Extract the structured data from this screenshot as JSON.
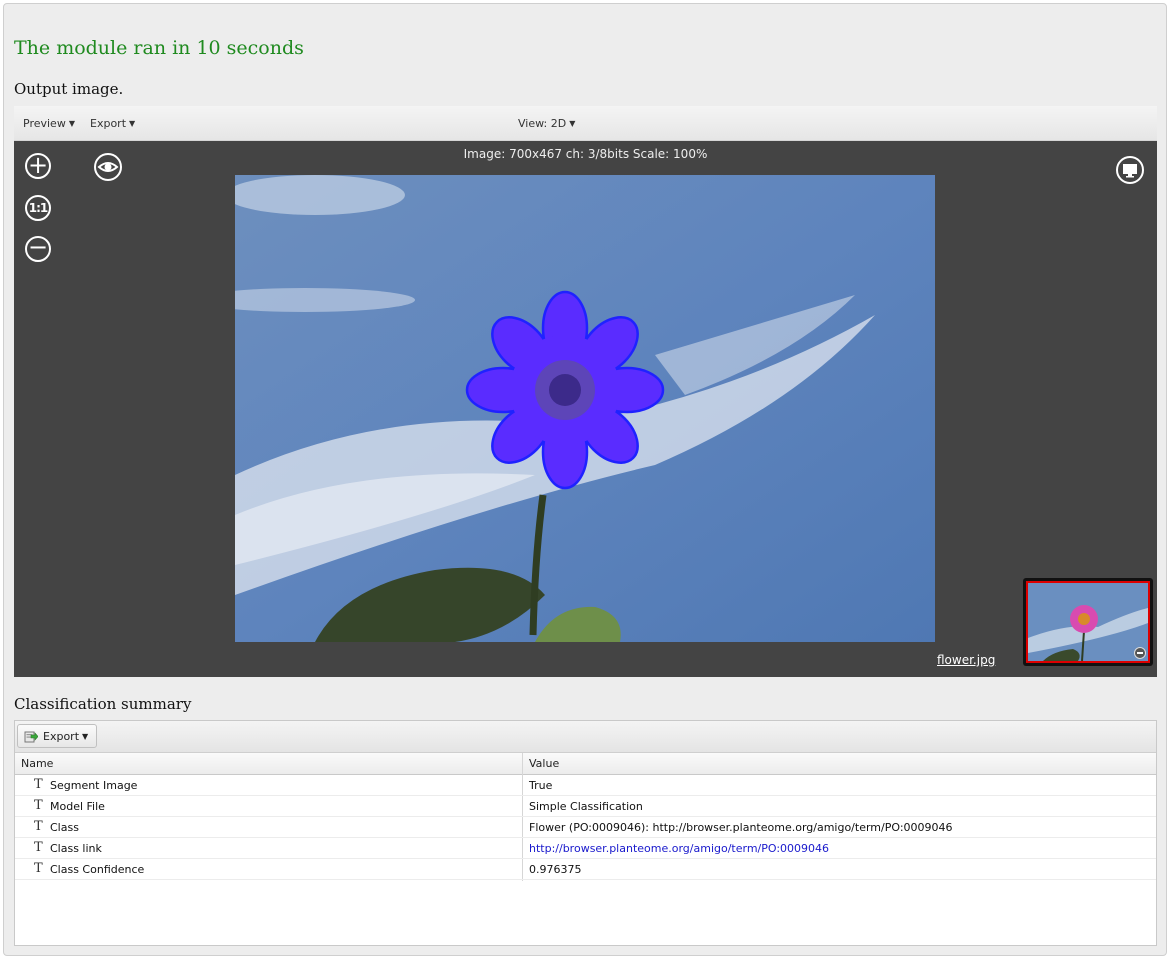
{
  "status_message": "The module ran in 10 seconds",
  "output_section": {
    "title": "Output image.",
    "toolbar": {
      "preview_label": "Preview",
      "export_label": "Export",
      "view_label": "View:",
      "view_value": "2D"
    },
    "viewer": {
      "image_info": "Image: 700x467 ch: 3/8bits Scale: 100%",
      "zoom_in_icon": "plus-circle-icon",
      "zoom_reset_label": "1:1",
      "zoom_out_icon": "minus-circle-icon",
      "visibility_icon": "eye-icon",
      "fullscreen_icon": "monitor-icon",
      "filename": "flower.jpg",
      "thumbnail_close_icon": "minus-circle-icon"
    }
  },
  "classification": {
    "title": "Classification summary",
    "export_label": "Export",
    "columns": [
      "Name",
      "Value"
    ],
    "rows": [
      {
        "icon": "T",
        "name": "Segment Image",
        "value": "True"
      },
      {
        "icon": "T",
        "name": "Model File",
        "value": "Simple Classification"
      },
      {
        "icon": "T",
        "name": "Class",
        "value": "Flower (PO:0009046): http://browser.planteome.org/amigo/term/PO:0009046"
      },
      {
        "icon": "T",
        "name": "Class link",
        "value": "http://browser.planteome.org/amigo/term/PO:0009046"
      },
      {
        "icon": "T",
        "name": "Class Confidence",
        "value": "0.976375"
      }
    ]
  },
  "colors": {
    "status_green": "#1f8a1f",
    "viewer_bg": "#444444",
    "link_blue": "#1a1acc",
    "segment_blue": "#5a2cff",
    "thumbnail_border": "#dd0000"
  }
}
